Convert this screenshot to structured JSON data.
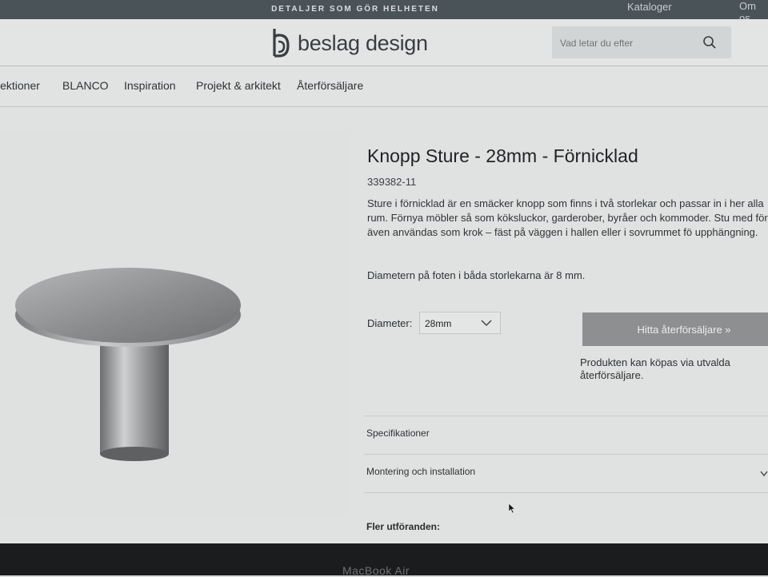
{
  "topbar": {
    "tagline": "DETALJER SOM GÖR HELHETEN",
    "catalog_link": "Kataloger",
    "about_link": "Om os"
  },
  "header": {
    "logo_text": "beslag design",
    "search_placeholder": "Vad letar du efter"
  },
  "nav": {
    "items": [
      {
        "label": "lektioner"
      },
      {
        "label": "BLANCO"
      },
      {
        "label": "Inspiration"
      },
      {
        "label": "Projekt & arkitekt"
      },
      {
        "label": "Återförsäljare"
      }
    ]
  },
  "product": {
    "title": "Knopp Sture - 28mm - Förnicklad",
    "sku": "339382-11",
    "description": "Sture i förnicklad är en smäcker knopp som finns i två storlekar och passar in i her alla rum. Förnya möbler så som köksluckor, garderober, byråer och kommoder. Stu med fördel även användas som krok – fäst på väggen i hallen eller i sovrummet fö upphängning.",
    "diameter_note": "Diametern på foten i båda storlekarna är 8 mm.",
    "diameter_label": "Diameter:",
    "diameter_value": "28mm",
    "find_button": "Hitta återförsäljare »",
    "buy_note": "Produkten kan köpas via utvalda återförsäljare."
  },
  "accordion": {
    "items": [
      {
        "label": "Specifikationer"
      },
      {
        "label": "Montering och installation"
      }
    ]
  },
  "variants_heading": "Fler utföranden:",
  "device_label": "MacBook Air",
  "colors": {
    "topbar": "#4a5358",
    "button": "#8d8f90",
    "page": "#e0e2e2"
  }
}
